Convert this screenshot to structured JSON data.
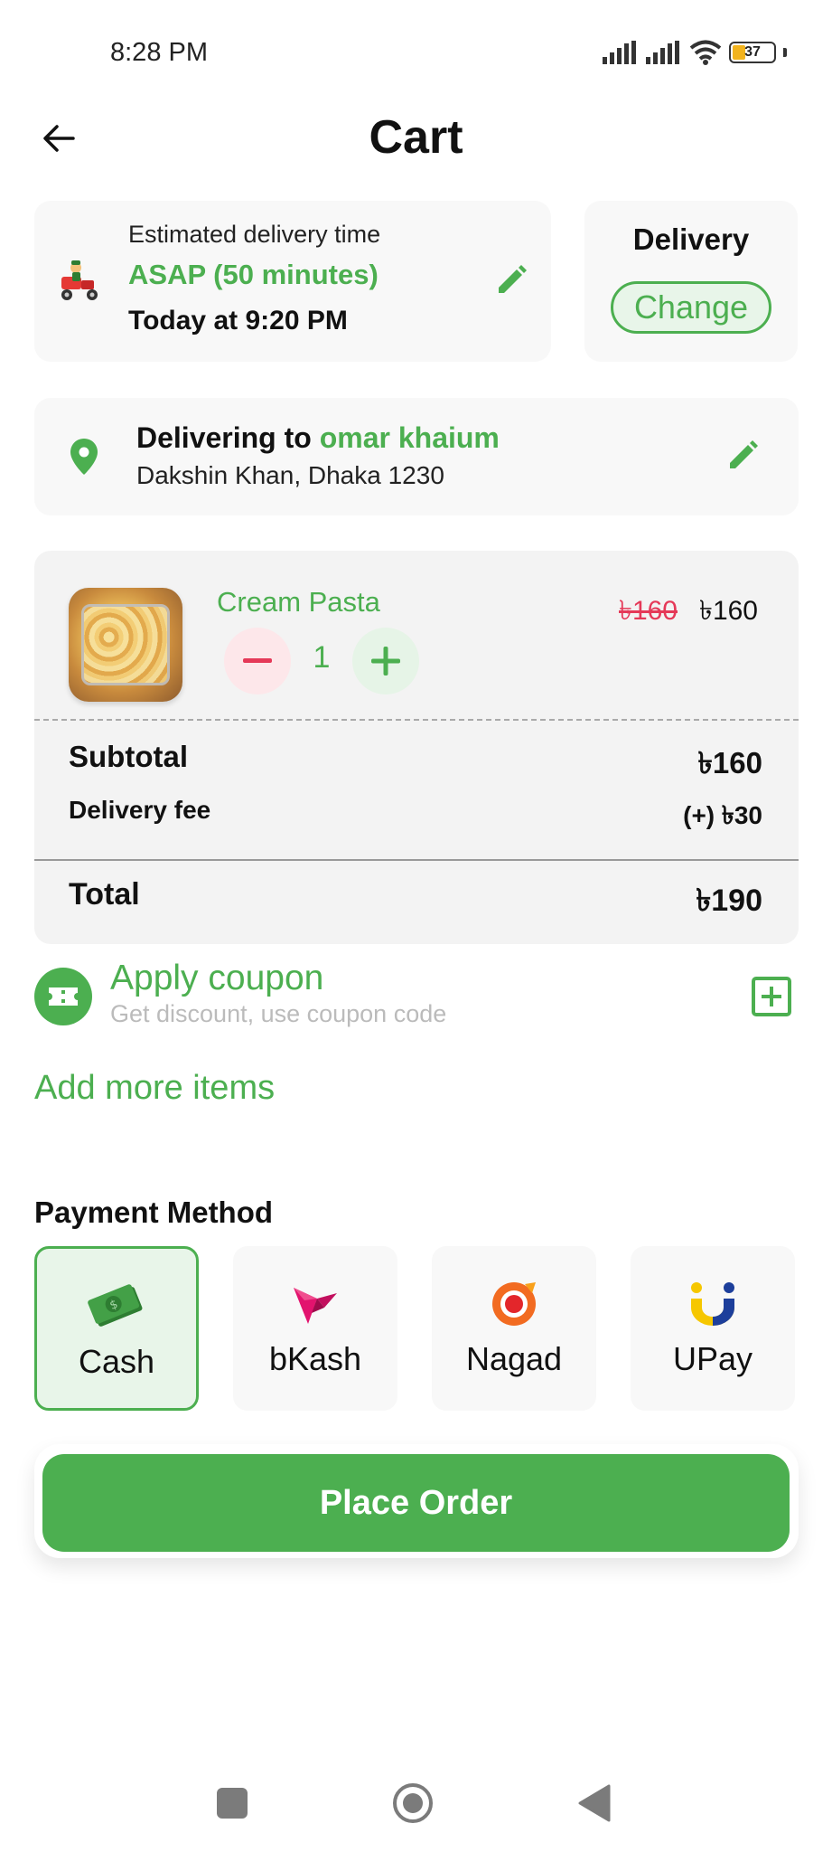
{
  "status_bar": {
    "time": "8:28 PM",
    "battery": "37",
    "icons": [
      "signal-icon",
      "signal-icon",
      "wifi-icon",
      "battery-icon"
    ]
  },
  "header": {
    "title": "Cart",
    "back_icon": "arrow-left-icon"
  },
  "delivery_time": {
    "label": "Estimated delivery time",
    "asap": "ASAP (50 minutes)",
    "today": "Today at 9:20 PM",
    "icon": "delivery-scooter-icon"
  },
  "delivery_mode": {
    "label": "Delivery",
    "change_label": "Change"
  },
  "address": {
    "prefix": "Delivering to ",
    "name": "omar khaium",
    "line": "Dakshin Khan, Dhaka 1230"
  },
  "cart": {
    "items": [
      {
        "name": "Cream Pasta",
        "old_price": "৳160",
        "price": "৳160",
        "quantity": "1"
      }
    ],
    "subtotal_label": "Subtotal",
    "subtotal": "৳160",
    "delivery_fee_label": "Delivery fee",
    "delivery_fee": "(+) ৳30",
    "total_label": "Total",
    "total": "৳190"
  },
  "coupon": {
    "title": "Apply coupon",
    "subtitle": "Get discount, use coupon code"
  },
  "add_more": "Add more items",
  "payment": {
    "title": "Payment Method",
    "options": [
      {
        "label": "Cash",
        "icon": "cash-icon",
        "selected": true
      },
      {
        "label": "bKash",
        "icon": "bkash-icon",
        "selected": false
      },
      {
        "label": "Nagad",
        "icon": "nagad-icon",
        "selected": false
      },
      {
        "label": "UPay",
        "icon": "upay-icon",
        "selected": false
      }
    ]
  },
  "place_order": "Place Order",
  "colors": {
    "accent": "#4caf50",
    "danger": "#e53958"
  }
}
